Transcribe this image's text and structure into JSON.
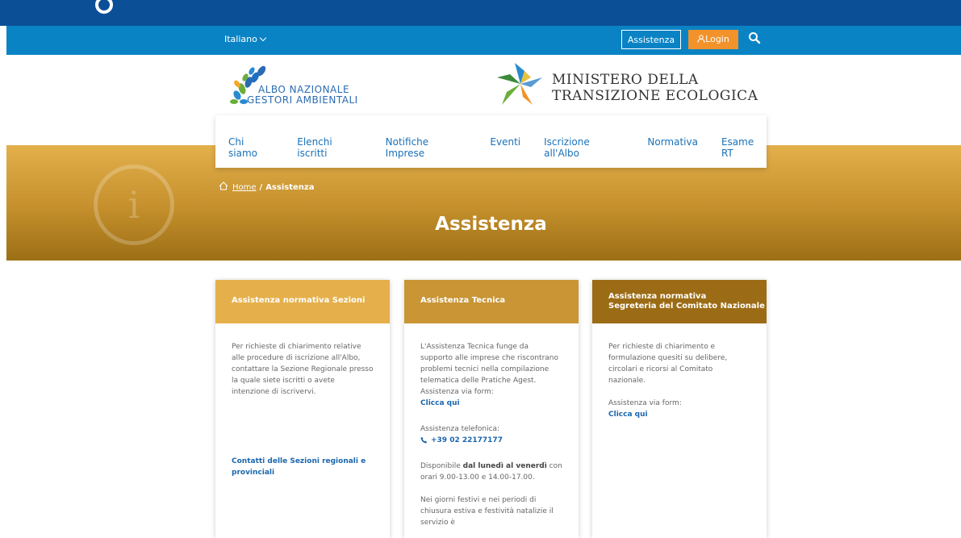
{
  "topbar": {
    "language": "Italiano",
    "assistenza_label": "Assistenza",
    "login_label": "Login"
  },
  "logos": {
    "albo_line1": "ALBO NAZIONALE",
    "albo_line2": "GESTORI AMBIENTALI",
    "ministero_line1": "MINISTERO DELLA",
    "ministero_line2": "TRANSIZIONE ECOLOGICA"
  },
  "nav": {
    "items": [
      "Chi siamo",
      "Elenchi iscritti",
      "Notifiche Imprese",
      "Eventi",
      "Iscrizione all'Albo",
      "Normativa",
      "Esame RT"
    ]
  },
  "breadcrumb": {
    "home": "Home",
    "separator": "/",
    "current": "Assistenza"
  },
  "hero": {
    "title": "Assistenza"
  },
  "cards": [
    {
      "title": "Assistenza normativa Sezioni",
      "color": "#e5b04b",
      "text": "Per richieste di chiarimento relative alle procedure di iscrizione all'Albo, contattare la Sezione Regionale presso la quale siete iscritti o avete intenzione di iscrivervi.",
      "link": "Contatti delle Sezioni regionali e provinciali"
    },
    {
      "title": "Assistenza Tecnica",
      "color": "#c99535",
      "text": "L'Assistenza Tecnica funge da supporto alle imprese che riscontrano problemi tecnici nella compilazione telematica delle Pratiche Agest.",
      "form_label": "Assistenza via form:",
      "form_link": "Clicca qui",
      "phone_label": "Assistenza telefonica:",
      "phone": "+39 02 22177177",
      "avail_pre": "Disponibile ",
      "avail_bold": "dal lunedì al venerdì",
      "avail_post": " con orari 9.00-13.00 e 14.00-17.00.",
      "holiday": "Nei giorni festivi e nei periodi di chiusura estiva e festività natalizie il servizio è"
    },
    {
      "title_line1": "Assistenza normativa",
      "title_line2": "Segreteria del Comitato Nazionale",
      "color": "#9b6b15",
      "text": "Per richieste di chiarimento e formulazione quesiti su delibere, circolari e ricorsi al Comitato nazionale.",
      "form_label": "Assistenza via form:",
      "form_link": "Clicca qui"
    }
  ]
}
